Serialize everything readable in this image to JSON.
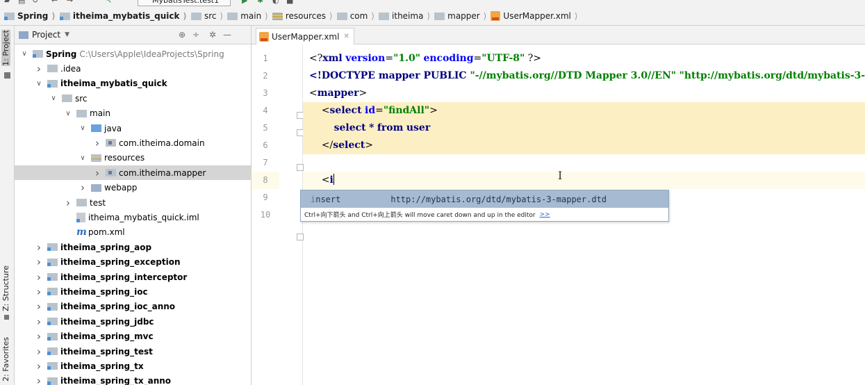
{
  "toolbar": {
    "run_config": "MybatisTest.test1"
  },
  "breadcrumb": [
    {
      "label": "Spring",
      "icon": "module-icon",
      "bold": true
    },
    {
      "label": "itheima_mybatis_quick",
      "icon": "module-icon",
      "bold": true
    },
    {
      "label": "src",
      "icon": "folder-icon",
      "bold": false
    },
    {
      "label": "main",
      "icon": "folder-icon",
      "bold": false
    },
    {
      "label": "resources",
      "icon": "resources-folder-icon",
      "bold": false
    },
    {
      "label": "com",
      "icon": "folder-icon",
      "bold": false
    },
    {
      "label": "itheima",
      "icon": "folder-icon",
      "bold": false
    },
    {
      "label": "mapper",
      "icon": "folder-icon",
      "bold": false
    },
    {
      "label": "UserMapper.xml",
      "icon": "xml-file-icon",
      "bold": false
    }
  ],
  "left_strip": {
    "project_tab": "1: Project",
    "structure_tab": "Z: Structure",
    "favorites_tab": "2: Favorites"
  },
  "project_panel": {
    "title": "Project",
    "tree": [
      {
        "indent": 0,
        "arrow": "down",
        "icon": "module",
        "label": "Spring",
        "bold": true,
        "path": "C:\\Users\\Apple\\IdeaProjects\\Spring"
      },
      {
        "indent": 1,
        "arrow": "right",
        "icon": "folder",
        "label": ".idea",
        "bold": false
      },
      {
        "indent": 1,
        "arrow": "down",
        "icon": "module",
        "label": "itheima_mybatis_quick",
        "bold": true
      },
      {
        "indent": 2,
        "arrow": "down",
        "icon": "folder",
        "label": "src",
        "bold": false
      },
      {
        "indent": 3,
        "arrow": "down",
        "icon": "folder",
        "label": "main",
        "bold": false
      },
      {
        "indent": 4,
        "arrow": "down",
        "icon": "src",
        "label": "java",
        "bold": false
      },
      {
        "indent": 5,
        "arrow": "right",
        "icon": "package",
        "label": "com.itheima.domain",
        "bold": false
      },
      {
        "indent": 4,
        "arrow": "down",
        "icon": "res",
        "label": "resources",
        "bold": false
      },
      {
        "indent": 5,
        "arrow": "right",
        "icon": "package",
        "label": "com.itheima.mapper",
        "bold": false,
        "selected": true
      },
      {
        "indent": 4,
        "arrow": "right",
        "icon": "web",
        "label": "webapp",
        "bold": false
      },
      {
        "indent": 3,
        "arrow": "right",
        "icon": "folder",
        "label": "test",
        "bold": false
      },
      {
        "indent": 3,
        "arrow": "none",
        "icon": "iml",
        "label": "itheima_mybatis_quick.iml",
        "bold": false
      },
      {
        "indent": 3,
        "arrow": "none",
        "icon": "maven",
        "label": "pom.xml",
        "bold": false
      },
      {
        "indent": 1,
        "arrow": "right",
        "icon": "module",
        "label": "itheima_spring_aop",
        "bold": true
      },
      {
        "indent": 1,
        "arrow": "right",
        "icon": "module",
        "label": "itheima_spring_exception",
        "bold": true
      },
      {
        "indent": 1,
        "arrow": "right",
        "icon": "module",
        "label": "itheima_spring_interceptor",
        "bold": true
      },
      {
        "indent": 1,
        "arrow": "right",
        "icon": "module",
        "label": "itheima_spring_ioc",
        "bold": true
      },
      {
        "indent": 1,
        "arrow": "right",
        "icon": "module",
        "label": "itheima_spring_ioc_anno",
        "bold": true
      },
      {
        "indent": 1,
        "arrow": "right",
        "icon": "module",
        "label": "itheima_spring_jdbc",
        "bold": true
      },
      {
        "indent": 1,
        "arrow": "right",
        "icon": "module",
        "label": "itheima_spring_mvc",
        "bold": true
      },
      {
        "indent": 1,
        "arrow": "right",
        "icon": "module",
        "label": "itheima_spring_test",
        "bold": true
      },
      {
        "indent": 1,
        "arrow": "right",
        "icon": "module",
        "label": "itheima_spring_tx",
        "bold": true
      },
      {
        "indent": 1,
        "arrow": "right",
        "icon": "module",
        "label": "itheima_spring_tx_anno",
        "bold": true
      }
    ]
  },
  "editor": {
    "tab_label": "UserMapper.xml",
    "line_numbers": [
      "1",
      "2",
      "3",
      "4",
      "5",
      "6",
      "7",
      "8",
      "9",
      "10"
    ],
    "current_line": "8",
    "completion": {
      "typed": "i",
      "rest": "nsert",
      "url": "http://mybatis.org/dtd/mybatis-3-mapper.dtd",
      "hint": "Ctrl+向下箭头 and Ctrl+向上箭头 will move caret down and up in the editor",
      "more_link": ">>"
    }
  },
  "colors": {
    "highlight_block": "#fcefc4",
    "current_line": "#fffbea",
    "completion_selected": "#a6bbd1",
    "tag_color": "#000080",
    "string_color": "#008000"
  }
}
